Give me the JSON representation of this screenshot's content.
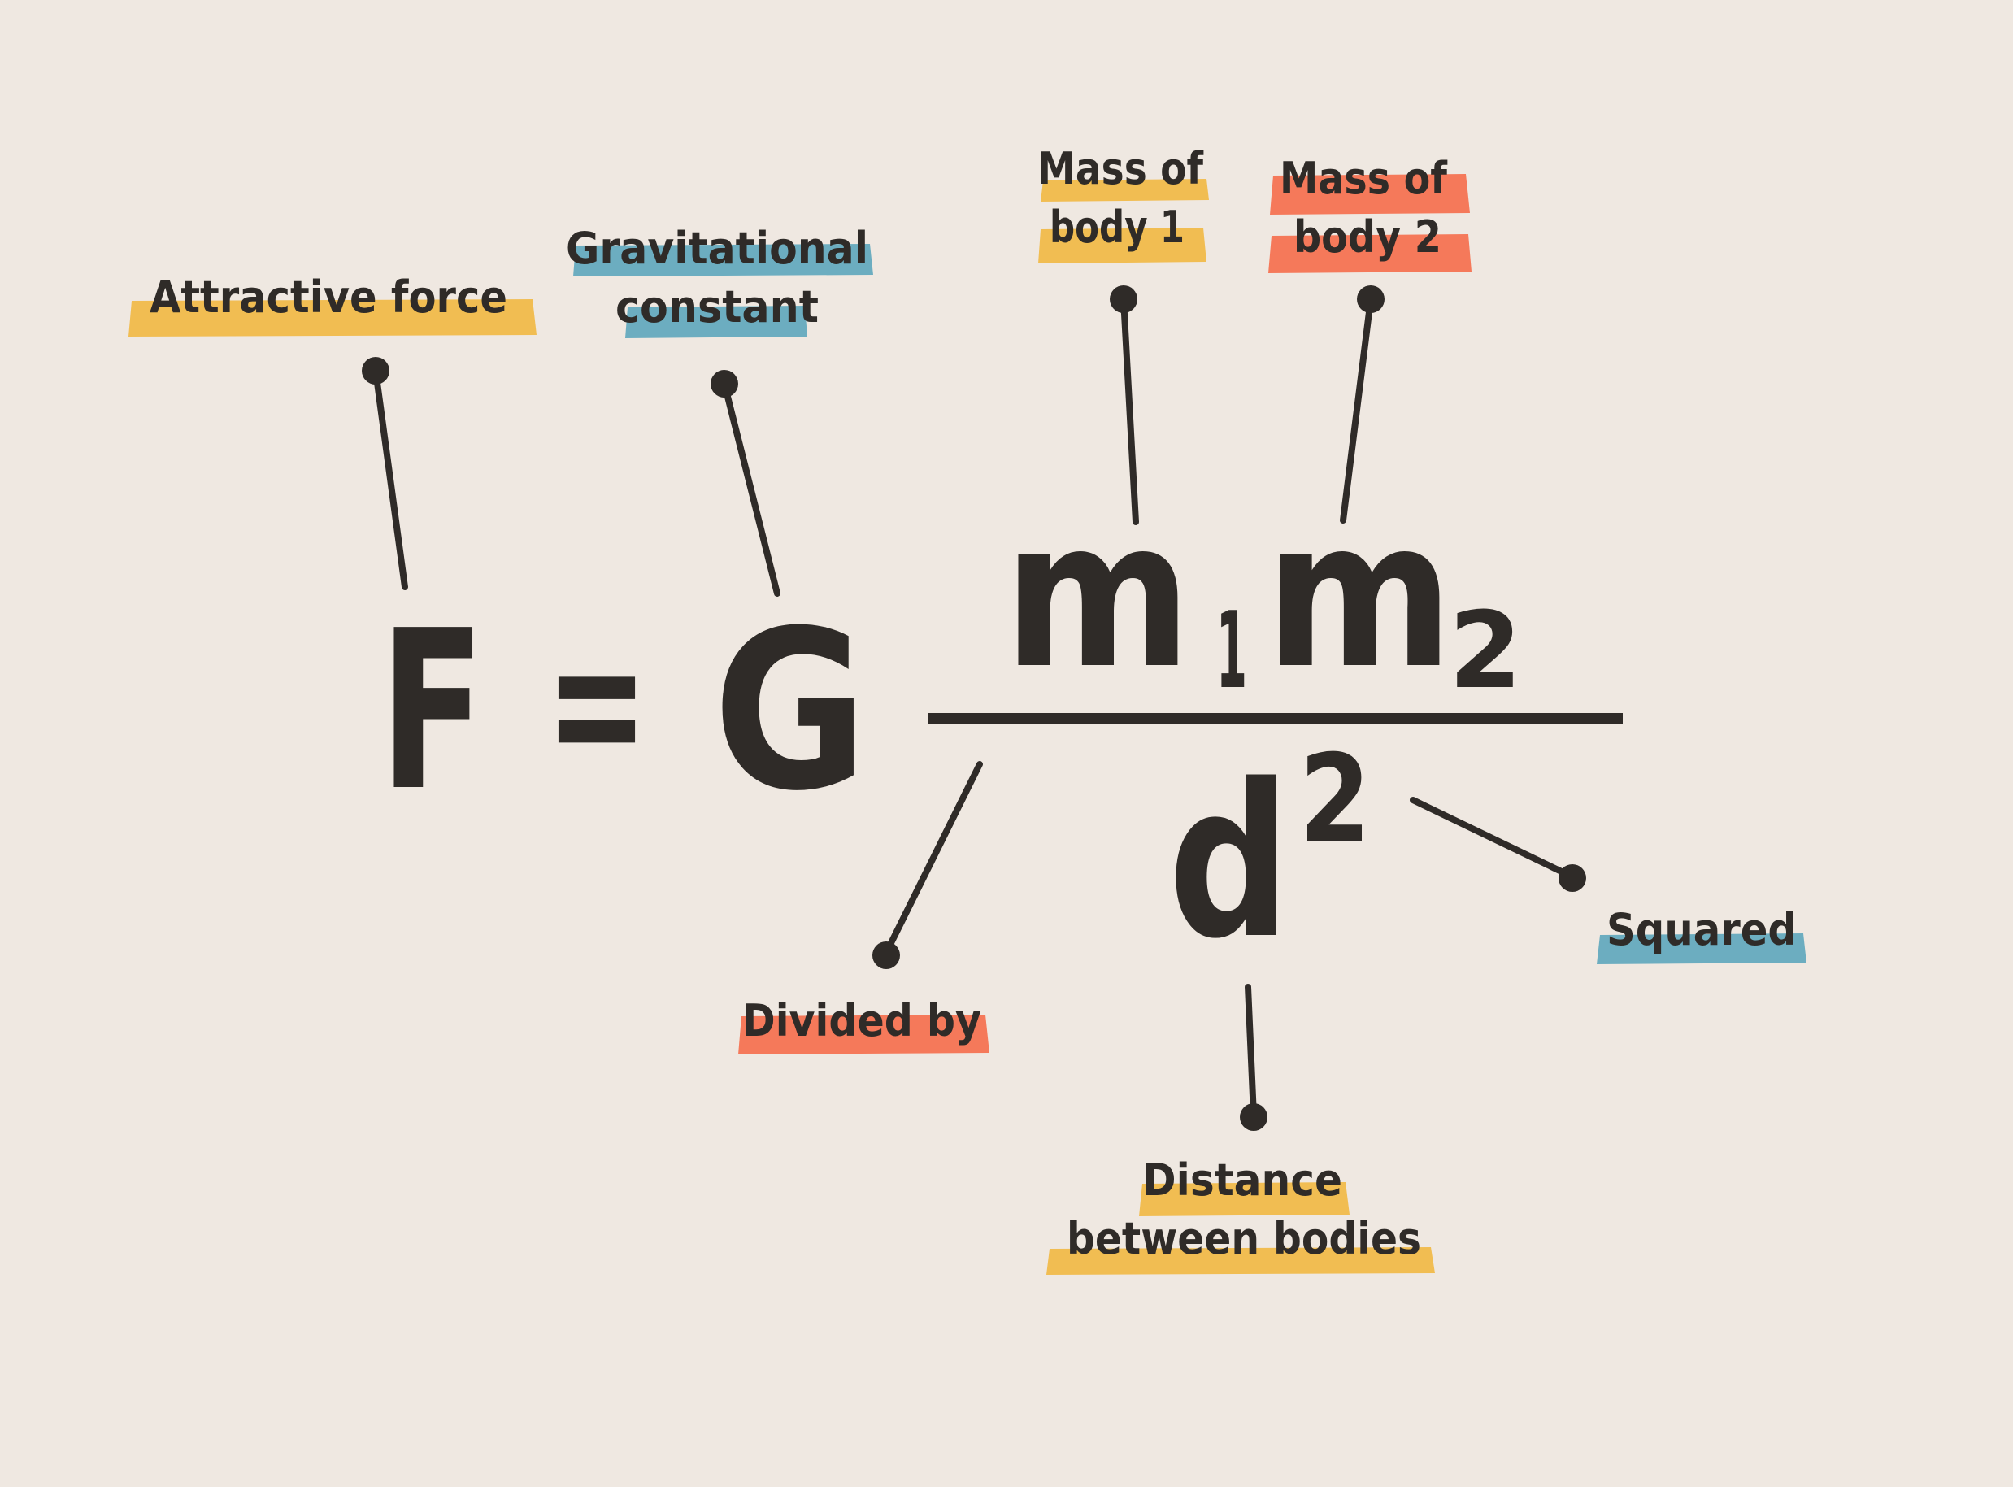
{
  "colors": {
    "background": "#efe8e1",
    "ink": "#2f2b28",
    "yellow": "#f1bd52",
    "blue": "#6cadc0",
    "orange": "#f5795a"
  },
  "formula": {
    "F": "F",
    "equals": "=",
    "G": "G",
    "m": "m",
    "sub1": "1",
    "sub2": "2",
    "d": "d",
    "exp2": "2"
  },
  "labels": {
    "attractive_force": "Attractive force",
    "gravitational_constant_1": "Gravitational",
    "gravitational_constant_2": "constant",
    "mass_body1_1": "Mass of",
    "mass_body1_2": "body 1",
    "mass_body2_1": "Mass of",
    "mass_body2_2": "body 2",
    "divided_by": "Divided by",
    "distance_1": "Distance",
    "distance_2": "between bodies",
    "squared": "Squared"
  }
}
